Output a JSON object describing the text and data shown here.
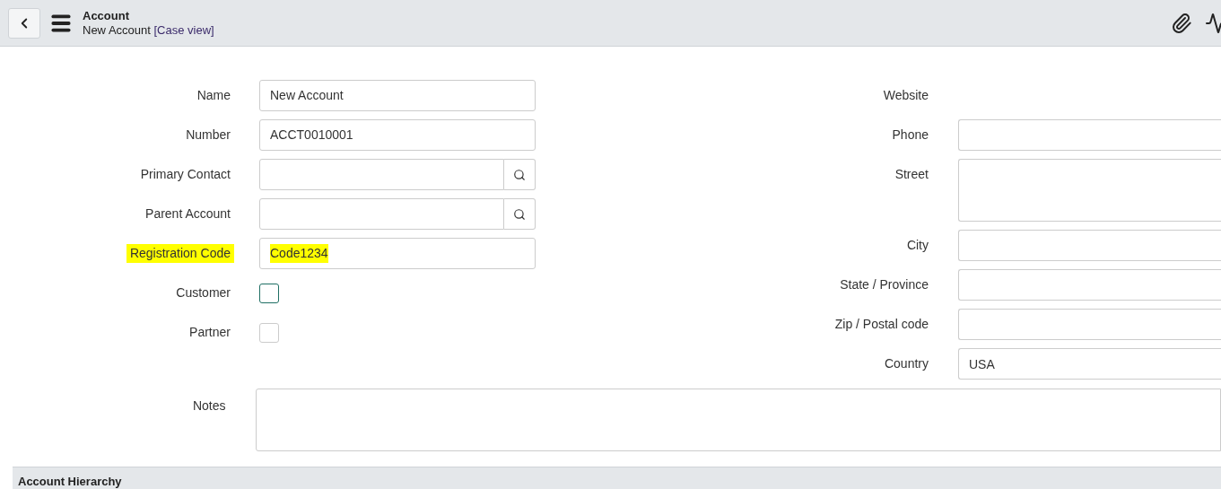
{
  "header": {
    "title": "Account",
    "subtitle": "New Account",
    "view": "[Case view]"
  },
  "left_fields": [
    {
      "label": "Name",
      "kind": "text",
      "value": "New Account",
      "highlighted": false
    },
    {
      "label": "Number",
      "kind": "text",
      "value": "ACCT0010001",
      "highlighted": false
    },
    {
      "label": "Primary Contact",
      "kind": "lookup",
      "highlighted": false
    },
    {
      "label": "Parent Account",
      "kind": "lookup",
      "highlighted": false
    },
    {
      "label": "Registration Code",
      "kind": "text",
      "value": "Code1234",
      "highlighted": true
    },
    {
      "label": "Customer",
      "kind": "checkbox",
      "checked": false,
      "color": "#1f6f64",
      "highlighted": false
    },
    {
      "label": "Partner",
      "kind": "checkbox",
      "checked": false,
      "color": "#cccccc",
      "highlighted": false
    }
  ],
  "right_fields": [
    {
      "label": "Website",
      "kind": "label"
    },
    {
      "label": "Phone",
      "kind": "text"
    },
    {
      "label": "Street",
      "kind": "textarea"
    },
    {
      "label": "City",
      "kind": "text"
    },
    {
      "label": "State / Province",
      "kind": "text"
    },
    {
      "label": "Zip / Postal code",
      "kind": "text"
    },
    {
      "label": "Country",
      "kind": "text",
      "value": "USA"
    }
  ],
  "notes": {
    "label": "Notes"
  },
  "section": {
    "title": "Account Hierarchy"
  }
}
